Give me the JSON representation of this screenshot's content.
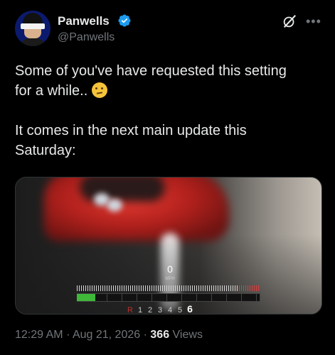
{
  "author": {
    "name": "Panwells",
    "handle": "@Panwells"
  },
  "tweet": {
    "line1": "Some of you've have requested this setting",
    "line2": "for a while..",
    "line3": "It comes in the next main update this",
    "line4": "Saturday:"
  },
  "media": {
    "speed_value": "0",
    "speed_unit": "MPH",
    "rpm_level_percent": 10,
    "gears": [
      "R",
      "1",
      "2",
      "3",
      "4",
      "5",
      "6"
    ],
    "current_gear": "6"
  },
  "meta": {
    "time": "12:29 AM",
    "dot1": "·",
    "date": "Aug 21, 2026",
    "dot2": "·",
    "views_count": "366",
    "views_label": "Views"
  },
  "icons": {
    "verified": "verified-badge-icon",
    "grok": "grok-icon",
    "more": "more-options-icon"
  },
  "colors": {
    "background": "#000000",
    "text": "#e7e9ea",
    "muted": "#71767b",
    "verified_blue": "#1d9bf0",
    "rpm_green": "#3fb83a"
  }
}
